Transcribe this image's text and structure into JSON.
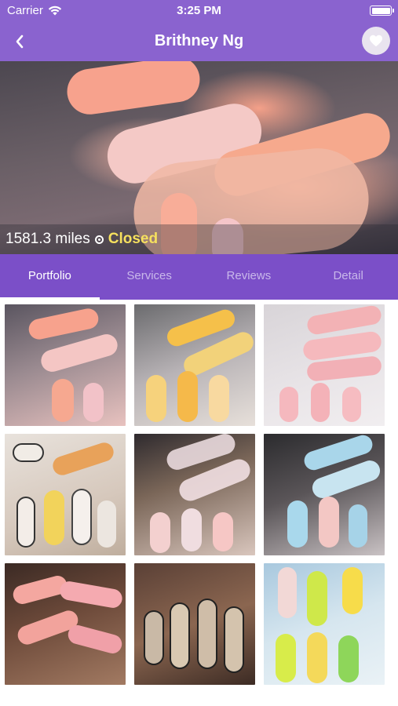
{
  "status_bar": {
    "carrier": "Carrier",
    "time": "3:25 PM",
    "icons": [
      "wifi-icon",
      "battery-icon"
    ]
  },
  "nav": {
    "title": "Brithney Ng",
    "back_icon": "chevron-left-icon",
    "favorite_icon": "heart-icon"
  },
  "hero": {
    "distance": "1581.3 miles",
    "status": "Closed",
    "status_color": "#f6e05e"
  },
  "tabs": [
    {
      "label": "Portfolio",
      "active": true
    },
    {
      "label": "Services",
      "active": false
    },
    {
      "label": "Reviews",
      "active": false
    },
    {
      "label": "Detail",
      "active": false
    }
  ],
  "colors": {
    "nav_bar": "#8a63cf",
    "tab_bar": "#7b4fc8",
    "tab_inactive": "#c9b8ea"
  },
  "portfolio_photo_count": 9
}
